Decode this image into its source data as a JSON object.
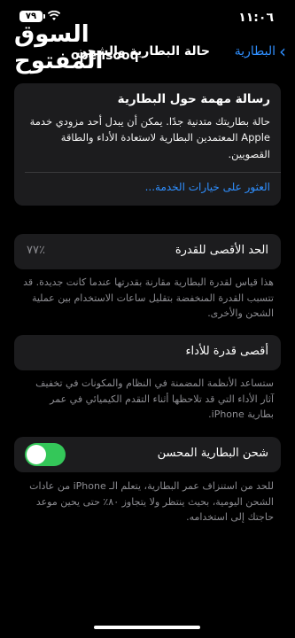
{
  "status": {
    "time": "١١:٠٦",
    "battery": "٧٩"
  },
  "watermark": {
    "arabic": "السوق المفتوح",
    "latin": "opensooq"
  },
  "nav": {
    "back_label": "البطارية",
    "title": "حالة البطارية والشحن"
  },
  "alert": {
    "title": "رسالة مهمة حول البطارية",
    "body": "حالة بطاريتك متدنية جدًا. يمكن أن يبدل أحد مزودي خدمة Apple المعتمدين البطارية لاستعادة الأداء والطاقة القصويين.",
    "link": "العثور على خيارات الخدمة..."
  },
  "max_capacity": {
    "label": "الحد الأقصى للقدرة",
    "value": "٪٧٧",
    "description": "هذا قياس لقدرة البطارية مقارنة بقدرتها عندما كانت جديدة. قد تتسبب القدرة المنخفضة بتقليل ساعات الاستخدام بين عملية الشحن والأخرى."
  },
  "peak_performance": {
    "label": "أقصى قدرة للأداء",
    "description": "ستساعد الأنظمة المضمنة في النظام والمكونات في تخفيف آثار الأداء التي قد تلاحظها أثناء التقدم الكيميائي في عمر بطارية iPhone."
  },
  "optimized_charging": {
    "label": "شحن البطارية المحسن",
    "enabled": true,
    "description": "للحد من استنزاف عمر البطارية، يتعلم الـ iPhone من عادات الشحن اليومية، بحيث ينتظر ولا يتجاوز ٨٠٪ حتى يحين موعد حاجتك إلى استخدامه."
  }
}
